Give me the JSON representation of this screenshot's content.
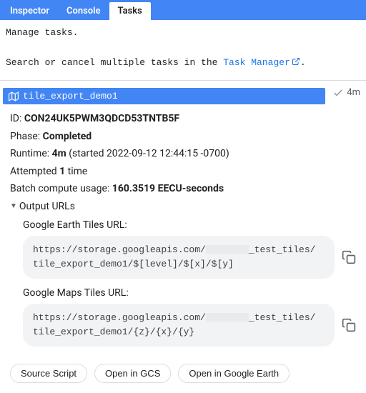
{
  "tabs": {
    "inspector": "Inspector",
    "console": "Console",
    "tasks": "Tasks"
  },
  "intro": {
    "line1": "Manage tasks.",
    "line2_pre": "Search or cancel multiple tasks in the ",
    "link": "Task Manager",
    "line2_post": "."
  },
  "task": {
    "title": "tile_export_demo1",
    "status_time": "4m",
    "id_label": "ID: ",
    "id": "CON24UK5PWM3QDCD53TNTB5F",
    "phase_label": "Phase: ",
    "phase": "Completed",
    "runtime_label": "Runtime: ",
    "runtime": "4m",
    "runtime_suffix": " (started 2022-09-12 12:44:15 -0700)",
    "attempt_pre": "Attempted ",
    "attempt_n": "1",
    "attempt_post": " time",
    "batch_label": "Batch compute usage: ",
    "batch": "160.3519 EECU-seconds",
    "output_label": "Output URLs",
    "urls": {
      "ge_label": "Google Earth Tiles URL:",
      "ge_pre": "https://storage.googleapis.com/",
      "ge_post": "_test_tiles/ tile_export_demo1/$[level]/$[x]/$[y]",
      "gm_label": "Google Maps Tiles URL:",
      "gm_pre": "https://storage.googleapis.com/",
      "gm_post": "_test_tiles/ tile_export_demo1/{z}/{x}/{y}"
    }
  },
  "actions": {
    "source": "Source Script",
    "gcs": "Open in GCS",
    "earth": "Open in Google Earth"
  }
}
